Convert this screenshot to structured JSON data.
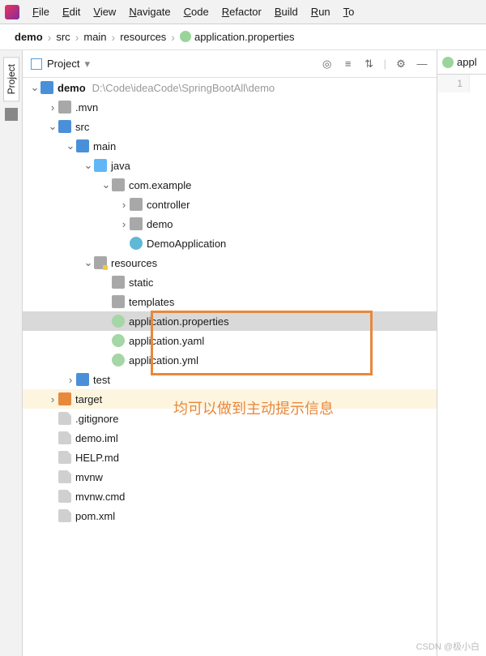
{
  "menu": {
    "items": [
      "File",
      "Edit",
      "View",
      "Navigate",
      "Code",
      "Refactor",
      "Build",
      "Run",
      "To"
    ]
  },
  "breadcrumb": [
    "demo",
    "src",
    "main",
    "resources",
    "application.properties"
  ],
  "panel": {
    "title": "Project",
    "dropdown": "▾"
  },
  "tree": {
    "root": {
      "name": "demo",
      "path": "D:\\Code\\ideaCode\\SpringBootAll\\demo"
    },
    "nodes": [
      {
        "d": 1,
        "a": ">",
        "t": "fold-grey",
        "n": ".mvn"
      },
      {
        "d": 1,
        "a": "v",
        "t": "fold-blue",
        "n": "src"
      },
      {
        "d": 2,
        "a": "v",
        "t": "fold-blue",
        "n": "main"
      },
      {
        "d": 3,
        "a": "v",
        "t": "fold-lblue",
        "n": "java"
      },
      {
        "d": 4,
        "a": "v",
        "t": "fold-grey",
        "n": "com.example"
      },
      {
        "d": 5,
        "a": ">",
        "t": "fold-grey",
        "n": "controller"
      },
      {
        "d": 5,
        "a": ">",
        "t": "fold-grey",
        "n": "demo"
      },
      {
        "d": 5,
        "a": "",
        "t": "class-icon",
        "n": "DemoApplication"
      },
      {
        "d": 3,
        "a": "v",
        "t": "fold-res",
        "n": "resources"
      },
      {
        "d": 4,
        "a": "",
        "t": "fold-grey",
        "n": "static"
      },
      {
        "d": 4,
        "a": "",
        "t": "fold-grey",
        "n": "templates"
      },
      {
        "d": 4,
        "a": "",
        "t": "file-cfg",
        "n": "application.properties",
        "sel": true
      },
      {
        "d": 4,
        "a": "",
        "t": "file-cfg",
        "n": "application.yaml"
      },
      {
        "d": 4,
        "a": "",
        "t": "file-cfg",
        "n": "application.yml"
      },
      {
        "d": 2,
        "a": ">",
        "t": "fold-blue",
        "n": "test"
      },
      {
        "d": 1,
        "a": ">",
        "t": "fold-orange",
        "n": "target",
        "tgt": true
      },
      {
        "d": 1,
        "a": "",
        "t": "file-grey",
        "n": ".gitignore"
      },
      {
        "d": 1,
        "a": "",
        "t": "file-grey",
        "n": "demo.iml"
      },
      {
        "d": 1,
        "a": "",
        "t": "file-grey",
        "n": "HELP.md"
      },
      {
        "d": 1,
        "a": "",
        "t": "file-grey",
        "n": "mvnw"
      },
      {
        "d": 1,
        "a": "",
        "t": "file-grey",
        "n": "mvnw.cmd"
      },
      {
        "d": 1,
        "a": "",
        "t": "file-grey",
        "n": "pom.xml"
      }
    ]
  },
  "annotation": "均可以做到主动提示信息",
  "sidebar": {
    "project": "Project"
  },
  "editor": {
    "tab": "appl",
    "line": "1"
  },
  "watermark": "CSDN @极小白"
}
